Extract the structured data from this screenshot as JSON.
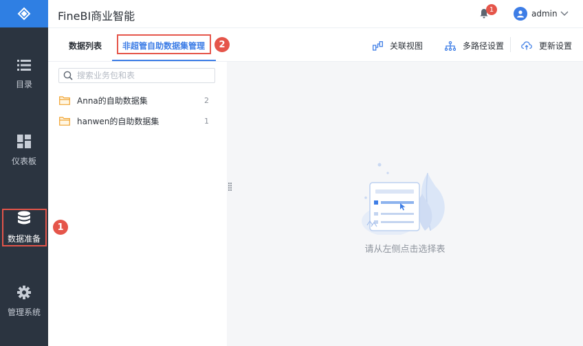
{
  "app": {
    "title": "FineBI商业智能"
  },
  "header": {
    "notification_count": "1",
    "user_name": "admin"
  },
  "sidebar": {
    "items": [
      {
        "label": "目录",
        "icon": "list-icon"
      },
      {
        "label": "仪表板",
        "icon": "dashboard-icon"
      },
      {
        "label": "数据准备",
        "icon": "database-icon",
        "active": true
      },
      {
        "label": "管理系统",
        "icon": "gear-icon"
      }
    ]
  },
  "callouts": {
    "first": "1",
    "second": "2"
  },
  "tabs": [
    {
      "label": "数据列表"
    },
    {
      "label": "非超管自助数据集管理",
      "active": true
    }
  ],
  "toolbar": {
    "relation_view": "关联视图",
    "multipath": "多路径设置",
    "update": "更新设置"
  },
  "search": {
    "placeholder": "搜索业务包和表"
  },
  "datasets": [
    {
      "name": "Anna的自助数据集",
      "count": "2"
    },
    {
      "name": "hanwen的自助数据集",
      "count": "1"
    }
  ],
  "empty_state": {
    "message": "请从左侧点击选择表"
  },
  "colors": {
    "brand": "#2f7fe3",
    "sidebar": "#2b3440",
    "callout": "#e5554a",
    "accent": "#3d7de6"
  }
}
